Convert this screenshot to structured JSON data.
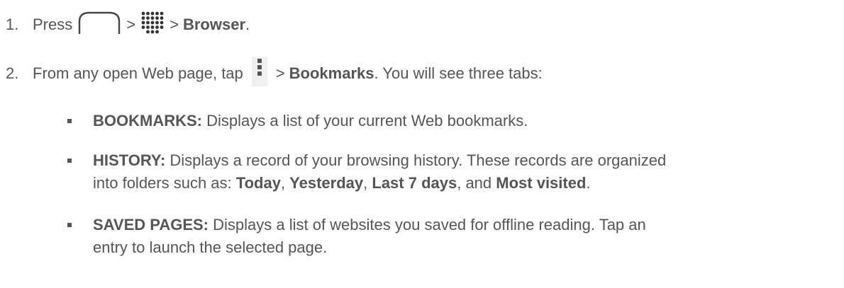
{
  "steps": [
    {
      "number": "1.",
      "text_before": "Press",
      "sep1": ">",
      "sep2": ">",
      "target": "Browser",
      "period": "."
    },
    {
      "number": "2.",
      "text_before": "From any open Web page, tap",
      "sep": ">",
      "target": "Bookmarks",
      "text_after": ". You will see three tabs:"
    }
  ],
  "tabs": [
    {
      "term": "BOOKMARKS:",
      "description": " Displays a list of your current Web bookmarks."
    },
    {
      "term": "HISTORY:",
      "description_line1": " Displays a record of your browsing history. These records are organized",
      "description_line2_prefix": "into folders such as: ",
      "folders": [
        "Today",
        "Yesterday",
        "Last 7 days",
        "Most visited"
      ],
      "sep_comma": ", ",
      "sep_and": ", and ",
      "period": "."
    },
    {
      "term": "SAVED PAGES:",
      "description_line1": " Displays a list of websites you saved for offline reading. Tap an",
      "description_line2": "entry to launch the selected page."
    }
  ],
  "icons": [
    "home-icon",
    "apps-icon",
    "menu-icon"
  ]
}
